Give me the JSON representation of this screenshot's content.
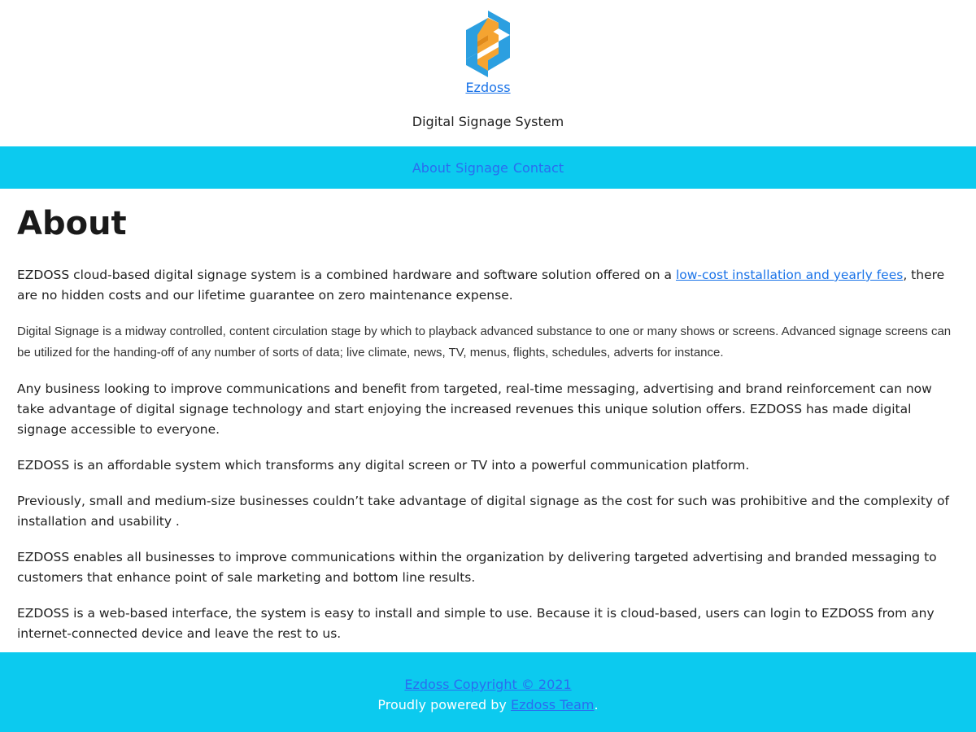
{
  "header": {
    "site_name": "Ezdoss",
    "tagline": "Digital Signage System",
    "logo_icon": "ezdoss-logo-icon"
  },
  "nav": {
    "items": [
      {
        "label": "About"
      },
      {
        "label": "Signage"
      },
      {
        "label": "Contact"
      }
    ]
  },
  "main": {
    "title": "About",
    "paragraphs": {
      "p1_before": "EZDOSS cloud-based digital signage system is a combined hardware and software solution offered on a ",
      "p1_link": "low-cost installation and yearly fees",
      "p1_after": ", there are no hidden costs and our lifetime guarantee on zero maintenance expense.",
      "p2": "Digital Signage is a midway controlled, content circulation stage by which to playback advanced substance to one or many shows or screens. Advanced signage screens can be utilized for the handing-off of any number of sorts of data; live climate, news, TV, menus, flights, schedules, adverts for instance.",
      "p3": "Any business looking to improve communications and benefit from targeted, real-time messaging, advertising and brand reinforcement can now take advantage of digital signage technology and start enjoying the increased revenues this unique solution offers. EZDOSS has made digital signage accessible to everyone.",
      "p4": "EZDOSS is an affordable system which transforms any digital screen or TV into a powerful communication platform.",
      "p5": "Previously, small and medium-size businesses couldn’t take advantage of digital signage as the cost for such was prohibitive and the complexity of installation and usability .",
      "p6": "EZDOSS enables all businesses to improve communications within the organization by delivering targeted advertising and branded messaging to customers that enhance point of sale marketing and bottom line results.",
      "p7": "EZDOSS is a web-based interface, the system is easy to install and simple to use. Because it is cloud-based, users can login to EZDOSS from any internet-connected device and leave the rest to us."
    }
  },
  "footer": {
    "copyright": "Ezdoss Copyright © 2021",
    "powered_prefix": "Proudly powered by ",
    "powered_link": "Ezdoss Team",
    "powered_suffix": "."
  },
  "colors": {
    "bar_cyan": "#0ccaef",
    "link_blue": "#1a73e8",
    "logo_blue": "#2c9fe0",
    "logo_orange": "#f5a431"
  }
}
